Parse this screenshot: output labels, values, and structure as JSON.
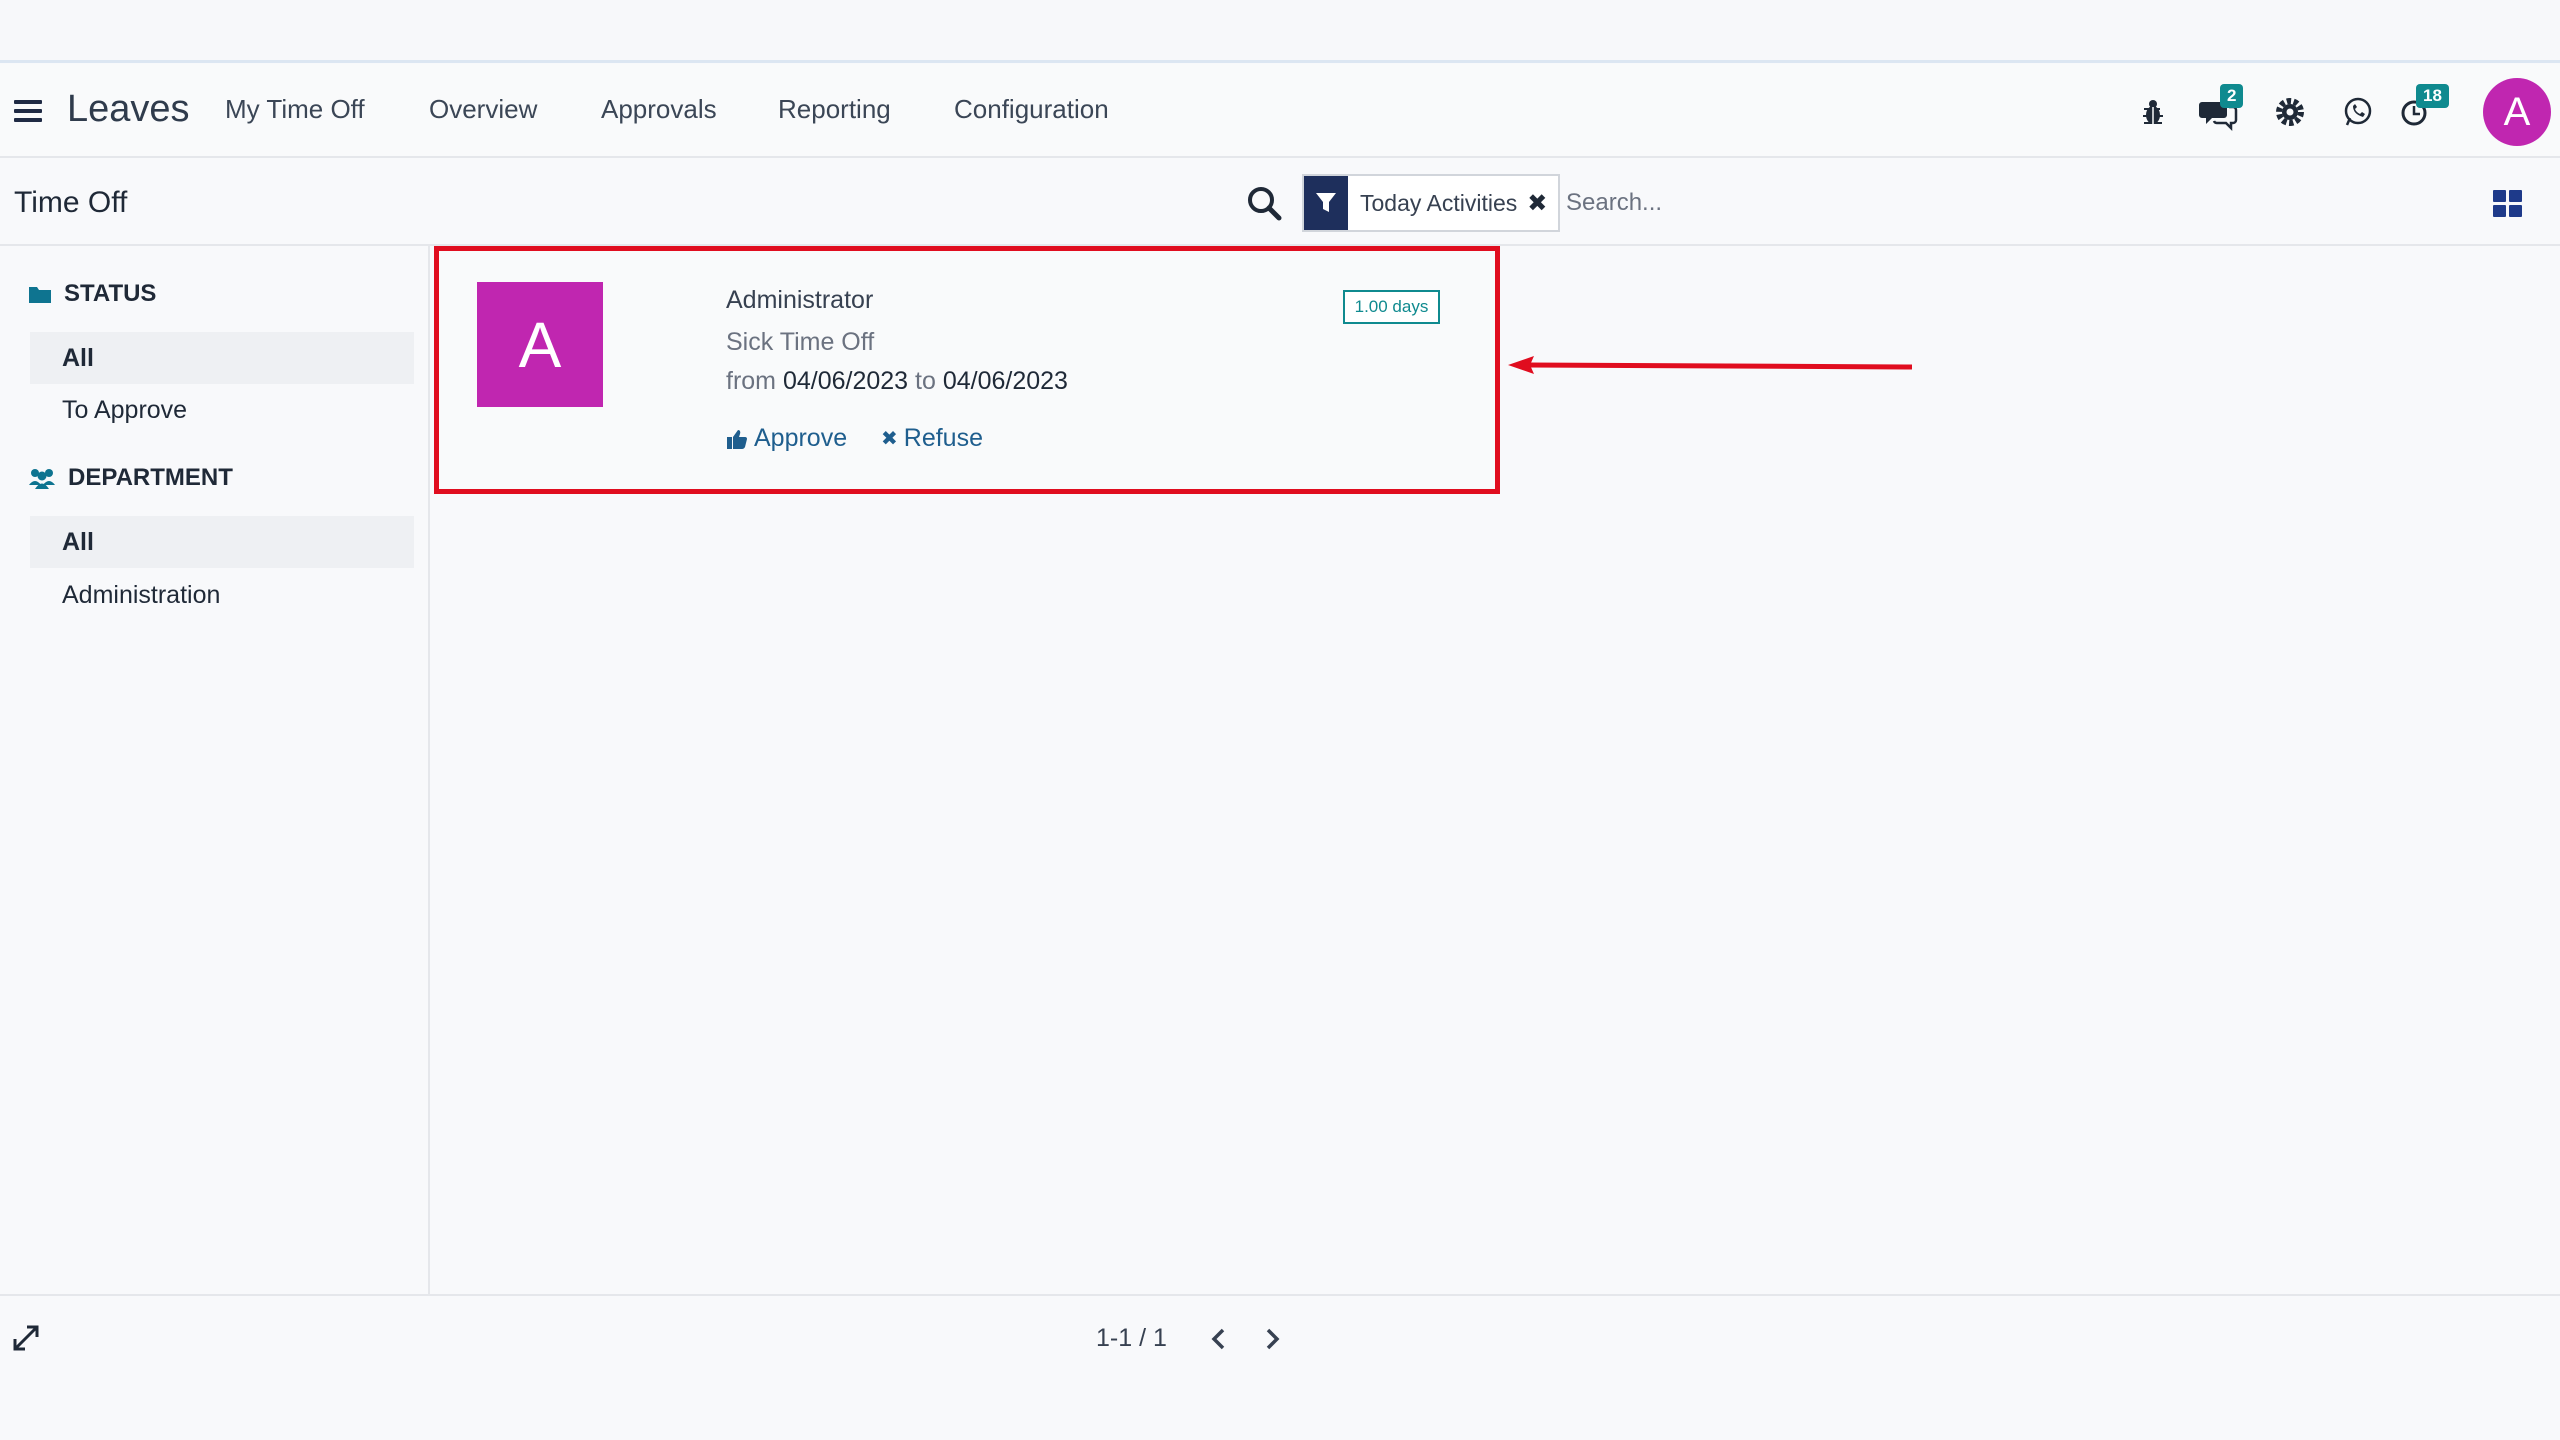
{
  "navbar": {
    "app_title": "Leaves",
    "menu": [
      "My Time Off",
      "Overview",
      "Approvals",
      "Reporting",
      "Configuration"
    ],
    "messages_badge": "2",
    "activities_badge": "18",
    "user_initial": "A",
    "icons": [
      "hamburger-icon",
      "bug-icon",
      "chat-icon",
      "gear-icon",
      "whatsapp-icon",
      "clock-icon"
    ]
  },
  "control": {
    "breadcrumb": "Time Off",
    "facet_label": "Today Activities",
    "search_placeholder": "Search..."
  },
  "sidebar": {
    "status_title": "STATUS",
    "status_items": [
      "All",
      "To Approve"
    ],
    "department_title": "DEPARTMENT",
    "department_items": [
      "All",
      "Administration"
    ]
  },
  "card": {
    "avatar_initial": "A",
    "employee": "Administrator",
    "leave_type": "Sick Time Off",
    "from_word": "from",
    "date_from": "04/06/2023",
    "to_word": "to",
    "date_to": "04/06/2023",
    "duration": "1.00 days",
    "approve_label": "Approve",
    "refuse_label": "Refuse"
  },
  "pager": {
    "value": "1-1 / 1"
  },
  "colors": {
    "accent": "#1e2f5c",
    "avatar": "#c026b0",
    "badge": "#0f8a8f",
    "highlight": "#e00d1f",
    "link": "#1f5e8e"
  }
}
